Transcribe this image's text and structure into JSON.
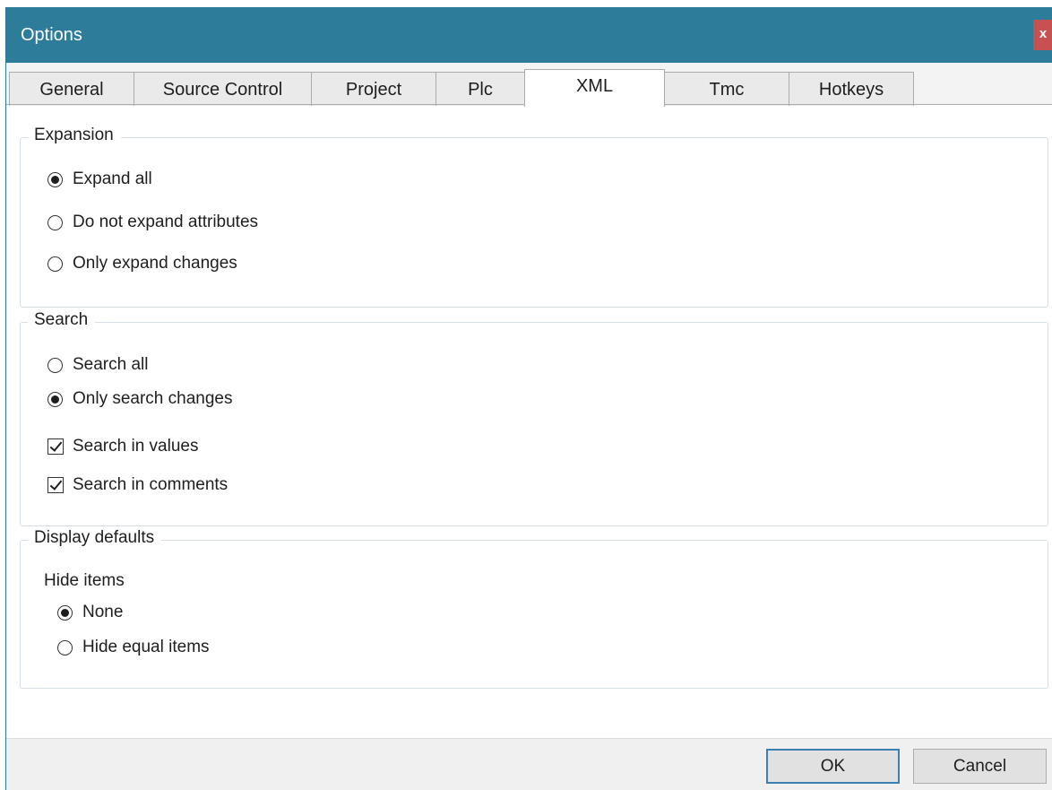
{
  "window": {
    "title": "Options",
    "close_glyph": "x"
  },
  "tabs": [
    {
      "label": "General",
      "active": false
    },
    {
      "label": "Source Control",
      "active": false
    },
    {
      "label": "Project",
      "active": false
    },
    {
      "label": "Plc",
      "active": false
    },
    {
      "label": "XML",
      "active": true
    },
    {
      "label": "Tmc",
      "active": false
    },
    {
      "label": "Hotkeys",
      "active": false
    }
  ],
  "expansion": {
    "legend": "Expansion",
    "options": [
      {
        "label": "Expand all",
        "checked": true
      },
      {
        "label": "Do not expand attributes",
        "checked": false
      },
      {
        "label": "Only expand changes",
        "checked": false
      }
    ]
  },
  "search": {
    "legend": "Search",
    "options": [
      {
        "label": "Search all",
        "checked": false
      },
      {
        "label": "Only search changes",
        "checked": true
      }
    ],
    "checkboxes": [
      {
        "label": "Search in values",
        "checked": true
      },
      {
        "label": "Search in comments",
        "checked": true
      }
    ]
  },
  "display_defaults": {
    "legend": "Display defaults",
    "hide_items_label": "Hide items",
    "options": [
      {
        "label": "None",
        "checked": true
      },
      {
        "label": "Hide equal items",
        "checked": false
      }
    ]
  },
  "footer": {
    "ok_label": "OK",
    "cancel_label": "Cancel"
  },
  "colors": {
    "titlebar": "#2d7d9a",
    "close": "#c75050",
    "group_border": "#d5dfe5"
  }
}
